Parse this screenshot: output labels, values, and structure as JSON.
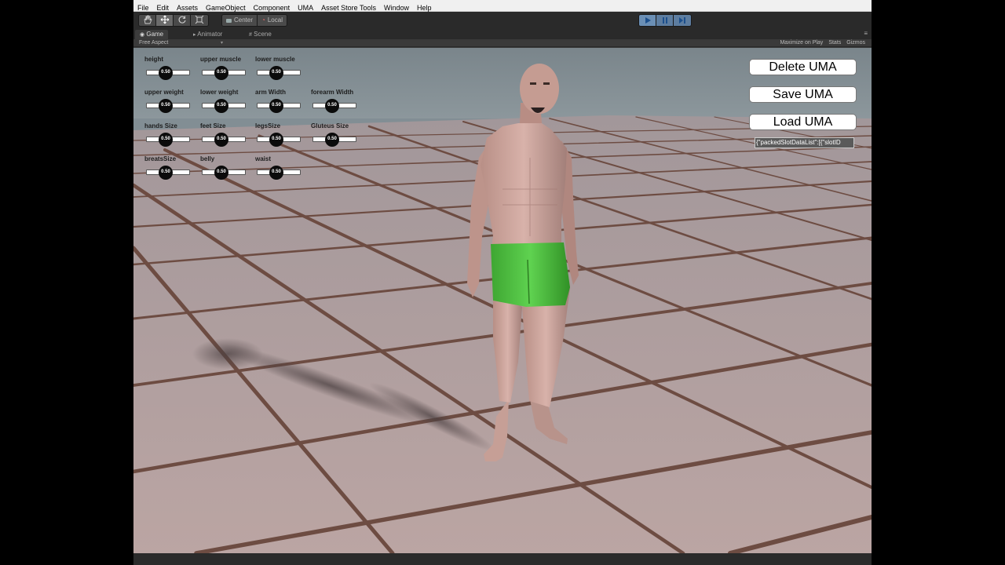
{
  "menu": [
    "File",
    "Edit",
    "Assets",
    "GameObject",
    "Component",
    "UMA",
    "Asset Store Tools",
    "Window",
    "Help"
  ],
  "toolbar": {
    "transform_tools": [
      "hand-icon",
      "move-icon",
      "rotate-icon",
      "scale-icon"
    ],
    "pivot": "Center",
    "space": "Local",
    "playback": [
      "play-icon",
      "pause-icon",
      "step-icon"
    ],
    "accent": "#6b8fb5"
  },
  "tabs": [
    "Game",
    "Animator",
    "Scene"
  ],
  "game_view": {
    "aspect": "Free Aspect",
    "maximize": "Maximize on Play",
    "stats": "Stats",
    "gizmos": "Gizmos"
  },
  "sliders": [
    {
      "label": "height",
      "value": "0.50"
    },
    {
      "label": "upper muscle",
      "value": "0.50"
    },
    {
      "label": "lower muscle",
      "value": "0.50"
    },
    {
      "label": "upper weight",
      "value": "0.50"
    },
    {
      "label": "lower weight",
      "value": "0.50"
    },
    {
      "label": "arm Width",
      "value": "0.50"
    },
    {
      "label": "forearm Width",
      "value": "0.50"
    },
    {
      "label": "hands Size",
      "value": "0.50"
    },
    {
      "label": "feet Size",
      "value": "0.50"
    },
    {
      "label": "legsSize",
      "value": "0.50"
    },
    {
      "label": "Gluteus Size",
      "value": "0.50"
    },
    {
      "label": "breatsSize",
      "value": "0.50"
    },
    {
      "label": "belly",
      "value": "0.50"
    },
    {
      "label": "waist",
      "value": "0.50"
    }
  ],
  "buttons": {
    "delete": "Delete UMA",
    "save": "Save UMA",
    "load": "Load UMA"
  },
  "uma_data_field": "{\"packedSlotDataList\":[{\"slotID"
}
